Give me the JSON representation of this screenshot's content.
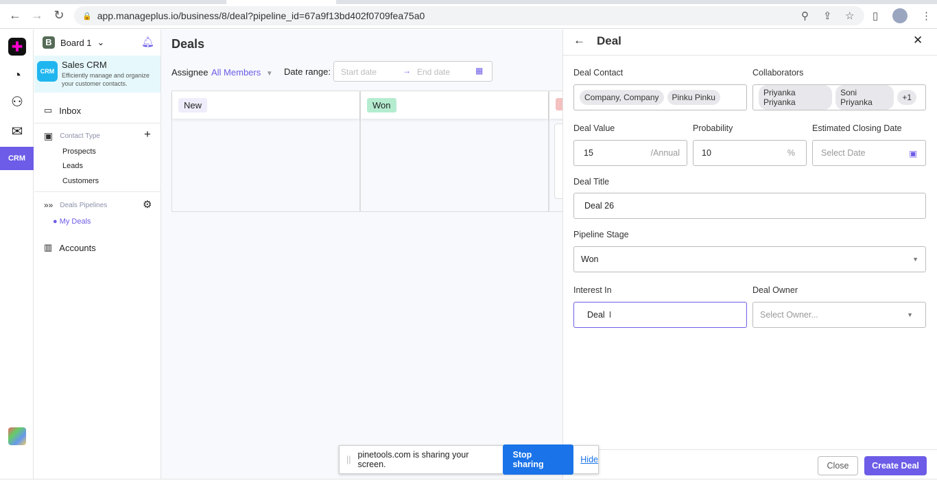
{
  "browser": {
    "url": "app.manageplus.io/business/8/deal?pipeline_id=67a9f13bd402f0709fea75a0"
  },
  "colors": {
    "accent": "#6c5ce7",
    "crm_bg": "#e6f8fb"
  },
  "sidebar": {
    "board": "Board 1",
    "board_initial": "B",
    "app_title": "Sales CRM",
    "app_desc": "Efficiently manage and organize your customer contacts.",
    "inbox": "Inbox",
    "contact_type": "Contact Type",
    "contact_items": [
      "Prospects",
      "Leads",
      "Customers"
    ],
    "deals_pipelines": "Deals Pipelines",
    "my_deals": "My Deals",
    "accounts": "Accounts",
    "rail_crm": "CRM"
  },
  "main": {
    "title": "Deals",
    "assignee_label": "Assignee",
    "assignee_value": "All Members",
    "date_range_label": "Date range:",
    "start_placeholder": "Start date",
    "end_placeholder": "End date",
    "columns": [
      {
        "label": "New",
        "color": "#efedfb"
      },
      {
        "label": "Won",
        "color": "#b5ecd0"
      }
    ]
  },
  "panel": {
    "title": "Deal",
    "deal_contact_label": "Deal Contact",
    "deal_contacts": [
      "Company, Company",
      "Pinku Pinku"
    ],
    "collaborators_label": "Collaborators",
    "collaborators": [
      "Priyanka Priyanka",
      "Soni Priyanka",
      "+1"
    ],
    "deal_value_label": "Deal Value",
    "deal_value": "15",
    "deal_value_suffix": "/Annual",
    "probability_label": "Probability",
    "probability": "10",
    "probability_suffix": "%",
    "closing_label": "Estimated Closing Date",
    "closing_placeholder": "Select Date",
    "title_label": "Deal Title",
    "title_value": "Deal 26",
    "stage_label": "Pipeline Stage",
    "stage_value": "Won",
    "interest_label": "Interest In",
    "interest_value": "Deal",
    "owner_label": "Deal Owner",
    "owner_placeholder": "Select Owner...",
    "close_btn": "Close",
    "create_btn": "Create Deal"
  },
  "share": {
    "text": "pinetools.com is sharing your screen.",
    "stop": "Stop sharing",
    "hide": "Hide"
  }
}
